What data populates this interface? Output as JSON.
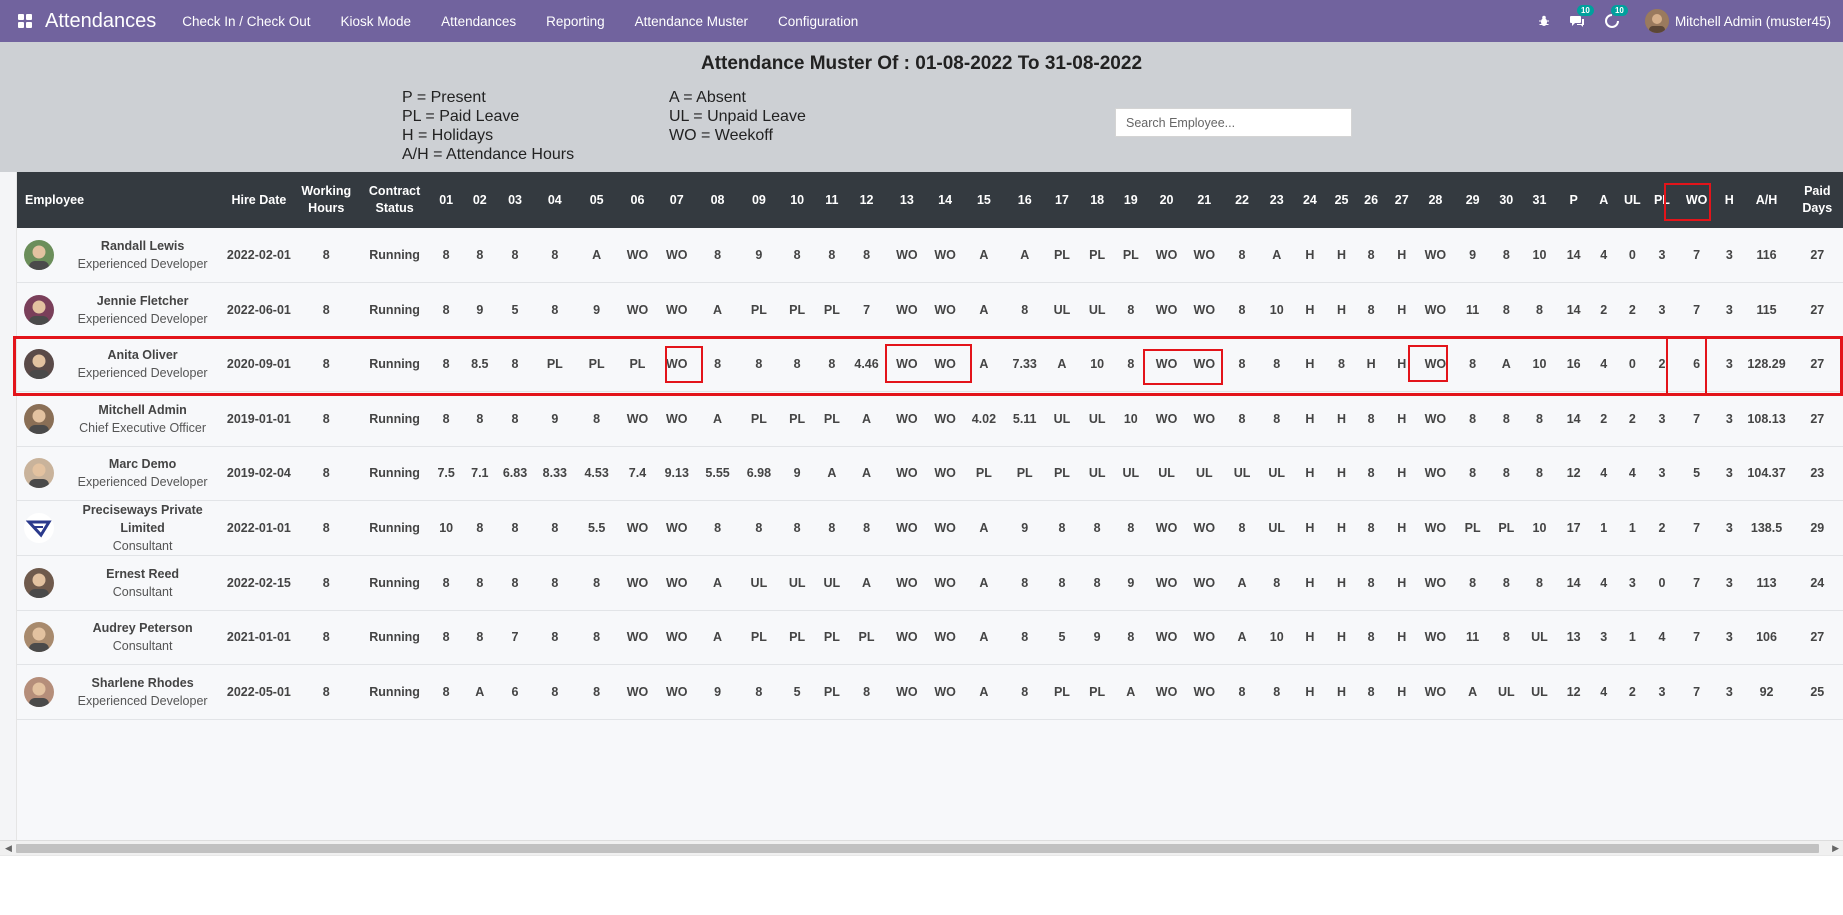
{
  "nav": {
    "app_title": "Attendances",
    "menu": [
      "Check In / Check Out",
      "Kiosk Mode",
      "Attendances",
      "Reporting",
      "Attendance Muster",
      "Configuration"
    ],
    "messages_badge": "10",
    "activity_badge": "10",
    "user": "Mitchell Admin (muster45)"
  },
  "report": {
    "title": "Attendance Muster Of : 01-08-2022 To 31-08-2022",
    "legend_left": [
      "P = Present",
      "PL = Paid Leave",
      "H = Holidays",
      "A/H = Attendance Hours"
    ],
    "legend_right": [
      "A = Absent",
      "UL = Unpaid Leave",
      "WO = Weekoff"
    ],
    "search_placeholder": "Search Employee..."
  },
  "table": {
    "headers": [
      "Employee",
      "Hire Date",
      "Working Hours",
      "Contract Status",
      "01",
      "02",
      "03",
      "04",
      "05",
      "06",
      "07",
      "08",
      "09",
      "10",
      "11",
      "12",
      "13",
      "14",
      "15",
      "16",
      "17",
      "18",
      "19",
      "20",
      "21",
      "22",
      "23",
      "24",
      "25",
      "26",
      "27",
      "28",
      "29",
      "30",
      "31",
      "P",
      "A",
      "UL",
      "PL",
      "WO",
      "H",
      "A/H",
      "Paid Days"
    ],
    "rows": [
      {
        "name": "Randall Lewis",
        "job": "Experienced Developer",
        "hire": "2022-02-01",
        "hours": "8",
        "status": "Running",
        "days": [
          "8",
          "8",
          "8",
          "8",
          "A",
          "WO",
          "WO",
          "8",
          "9",
          "8",
          "8",
          "8",
          "WO",
          "WO",
          "A",
          "A",
          "PL",
          "PL",
          "PL",
          "WO",
          "WO",
          "8",
          "A",
          "H",
          "H",
          "8",
          "H",
          "WO",
          "9",
          "8",
          "10"
        ],
        "summary": [
          "14",
          "4",
          "0",
          "3",
          "7",
          "3",
          "116",
          "27"
        ]
      },
      {
        "name": "Jennie Fletcher",
        "job": "Experienced Developer",
        "hire": "2022-06-01",
        "hours": "8",
        "status": "Running",
        "days": [
          "8",
          "9",
          "5",
          "8",
          "9",
          "WO",
          "WO",
          "A",
          "PL",
          "PL",
          "PL",
          "7",
          "WO",
          "WO",
          "A",
          "8",
          "UL",
          "UL",
          "8",
          "WO",
          "WO",
          "8",
          "10",
          "H",
          "H",
          "8",
          "H",
          "WO",
          "11",
          "8",
          "8"
        ],
        "summary": [
          "14",
          "2",
          "2",
          "3",
          "7",
          "3",
          "115",
          "27"
        ]
      },
      {
        "name": "Anita Oliver",
        "job": "Experienced Developer",
        "hire": "2020-09-01",
        "hours": "8",
        "status": "Running",
        "days": [
          "8",
          "8.5",
          "8",
          "PL",
          "PL",
          "PL",
          "WO",
          "8",
          "8",
          "8",
          "8",
          "4.46",
          "WO",
          "WO",
          "A",
          "7.33",
          "A",
          "10",
          "8",
          "WO",
          "WO",
          "8",
          "8",
          "H",
          "8",
          "H",
          "H",
          "WO",
          "8",
          "A",
          "10"
        ],
        "summary": [
          "16",
          "4",
          "0",
          "2",
          "6",
          "3",
          "128.29",
          "27"
        ]
      },
      {
        "name": "Mitchell Admin",
        "job": "Chief Executive Officer",
        "hire": "2019-01-01",
        "hours": "8",
        "status": "Running",
        "days": [
          "8",
          "8",
          "8",
          "9",
          "8",
          "WO",
          "WO",
          "A",
          "PL",
          "PL",
          "PL",
          "A",
          "WO",
          "WO",
          "4.02",
          "5.11",
          "UL",
          "UL",
          "10",
          "WO",
          "WO",
          "8",
          "8",
          "H",
          "H",
          "8",
          "H",
          "WO",
          "8",
          "8",
          "8"
        ],
        "summary": [
          "14",
          "2",
          "2",
          "3",
          "7",
          "3",
          "108.13",
          "27"
        ]
      },
      {
        "name": "Marc Demo",
        "job": "Experienced Developer",
        "hire": "2019-02-04",
        "hours": "8",
        "status": "Running",
        "days": [
          "7.5",
          "7.1",
          "6.83",
          "8.33",
          "4.53",
          "7.4",
          "9.13",
          "5.55",
          "6.98",
          "9",
          "A",
          "A",
          "WO",
          "WO",
          "PL",
          "PL",
          "PL",
          "UL",
          "UL",
          "UL",
          "UL",
          "UL",
          "UL",
          "H",
          "H",
          "8",
          "H",
          "WO",
          "8",
          "8",
          "8"
        ],
        "summary": [
          "12",
          "4",
          "4",
          "3",
          "5",
          "3",
          "104.37",
          "23"
        ]
      },
      {
        "name": "Preciseways Private Limited",
        "job": "Consultant",
        "hire": "2022-01-01",
        "hours": "8",
        "status": "Running",
        "days": [
          "10",
          "8",
          "8",
          "8",
          "5.5",
          "WO",
          "WO",
          "8",
          "8",
          "8",
          "8",
          "8",
          "WO",
          "WO",
          "A",
          "9",
          "8",
          "8",
          "8",
          "WO",
          "WO",
          "8",
          "UL",
          "H",
          "H",
          "8",
          "H",
          "WO",
          "PL",
          "PL",
          "10"
        ],
        "summary": [
          "17",
          "1",
          "1",
          "2",
          "7",
          "3",
          "138.5",
          "29"
        ]
      },
      {
        "name": "Ernest Reed",
        "job": "Consultant",
        "hire": "2022-02-15",
        "hours": "8",
        "status": "Running",
        "days": [
          "8",
          "8",
          "8",
          "8",
          "8",
          "WO",
          "WO",
          "A",
          "UL",
          "UL",
          "UL",
          "A",
          "WO",
          "WO",
          "A",
          "8",
          "8",
          "8",
          "9",
          "WO",
          "WO",
          "A",
          "8",
          "H",
          "H",
          "8",
          "H",
          "WO",
          "8",
          "8",
          "8"
        ],
        "summary": [
          "14",
          "4",
          "3",
          "0",
          "7",
          "3",
          "113",
          "24"
        ]
      },
      {
        "name": "Audrey Peterson",
        "job": "Consultant",
        "hire": "2021-01-01",
        "hours": "8",
        "status": "Running",
        "days": [
          "8",
          "8",
          "7",
          "8",
          "8",
          "WO",
          "WO",
          "A",
          "PL",
          "PL",
          "PL",
          "PL",
          "WO",
          "WO",
          "A",
          "8",
          "5",
          "9",
          "8",
          "WO",
          "WO",
          "A",
          "10",
          "H",
          "H",
          "8",
          "H",
          "WO",
          "11",
          "8",
          "UL"
        ],
        "summary": [
          "13",
          "3",
          "1",
          "4",
          "7",
          "3",
          "106",
          "27"
        ]
      },
      {
        "name": "Sharlene Rhodes",
        "job": "Experienced Developer",
        "hire": "2022-05-01",
        "hours": "8",
        "status": "Running",
        "days": [
          "8",
          "A",
          "6",
          "8",
          "8",
          "WO",
          "WO",
          "9",
          "8",
          "5",
          "PL",
          "8",
          "WO",
          "WO",
          "A",
          "8",
          "PL",
          "PL",
          "A",
          "WO",
          "WO",
          "8",
          "8",
          "H",
          "H",
          "8",
          "H",
          "WO",
          "A",
          "UL",
          "UL"
        ],
        "summary": [
          "12",
          "4",
          "2",
          "3",
          "7",
          "3",
          "92",
          "25"
        ]
      }
    ]
  },
  "colors": {
    "navbar": "#71639e",
    "header_panel": "#cdd0d4",
    "table_header": "#343a40",
    "highlight": "#e3141a",
    "badge": "#00a09d"
  }
}
